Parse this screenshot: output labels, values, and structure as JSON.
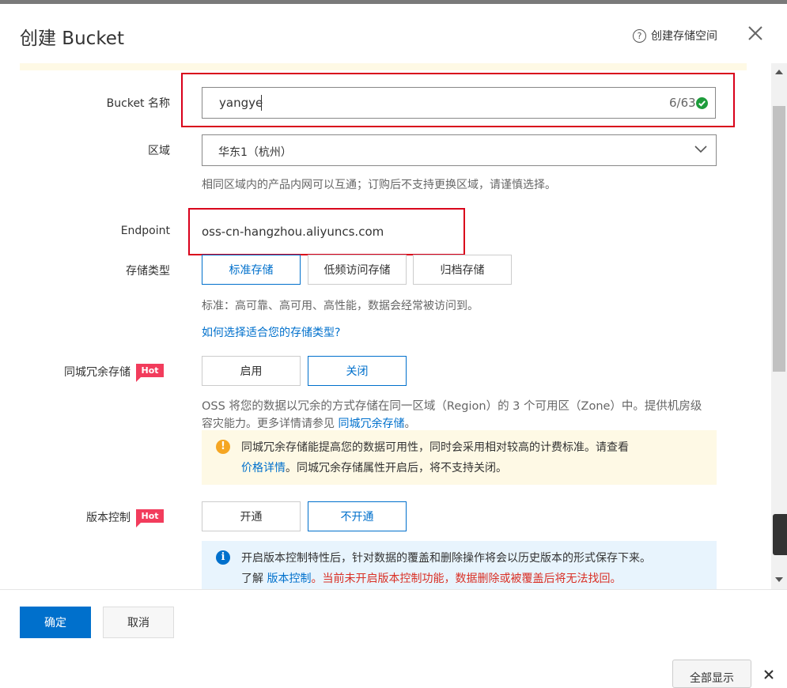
{
  "dialog": {
    "title": "创建 Bucket",
    "help_link": "创建存储空间",
    "help_icon": "?"
  },
  "form": {
    "bucket_name": {
      "label": "Bucket 名称",
      "value": "yangye",
      "counter": "6/63"
    },
    "region": {
      "label": "区域",
      "value": "华东1（杭州）",
      "hint": "相同区域内的产品内网可以互通；订购后不支持更换区域，请谨慎选择。"
    },
    "endpoint": {
      "label": "Endpoint",
      "value": "oss-cn-hangzhou.aliyuncs.com"
    },
    "storage_type": {
      "label": "存储类型",
      "options": [
        "标准存储",
        "低频访问存储",
        "归档存储"
      ],
      "selected": "标准存储",
      "hint": "标准：高可靠、高可用、高性能，数据会经常被访问到。",
      "help_link": "如何选择适合您的存储类型?"
    },
    "zone_redundancy": {
      "label": "同城冗余存储",
      "badge": "Hot",
      "options": [
        "启用",
        "关闭"
      ],
      "selected": "关闭",
      "hint_line1": "OSS 将您的数据以冗余的方式存储在同一区域（Region）的 3 个可用区（Zone）中。提供机房级",
      "hint_line2_prefix": "容灾能力。更多详情请参见 ",
      "hint_link": "同城冗余存储",
      "hint_line2_suffix": "。",
      "notice_icon": "!",
      "notice_line1": "同城冗余存储能提高您的数据可用性，同时会采用相对较高的计费标准。请查看",
      "notice_link": "价格详情",
      "notice_line2": "。同城冗余存储属性开启后，将不支持关闭。"
    },
    "versioning": {
      "label": "版本控制",
      "badge": "Hot",
      "options": [
        "开通",
        "不开通"
      ],
      "selected": "不开通",
      "notice_icon": "i",
      "notice_line1": "开启版本控制特性后，针对数据的覆盖和删除操作将会以历史版本的形式保存下来。",
      "notice_prefix": "了解 ",
      "notice_link": "版本控制",
      "notice_warning": "。当前未开启版本控制功能，数据删除或被覆盖后将无法找回。"
    }
  },
  "footer": {
    "ok_label": "确定",
    "cancel_label": "取消",
    "show_all_label": "全部显示"
  },
  "colors": {
    "primary": "#0070cc",
    "highlight_box": "#d9001b",
    "hot_badge": "#f23c5c",
    "warning_bg": "#fef9e5",
    "info_bg": "#e8f4fd",
    "warning_red": "#d93026",
    "success_green": "#1e9c3b"
  }
}
